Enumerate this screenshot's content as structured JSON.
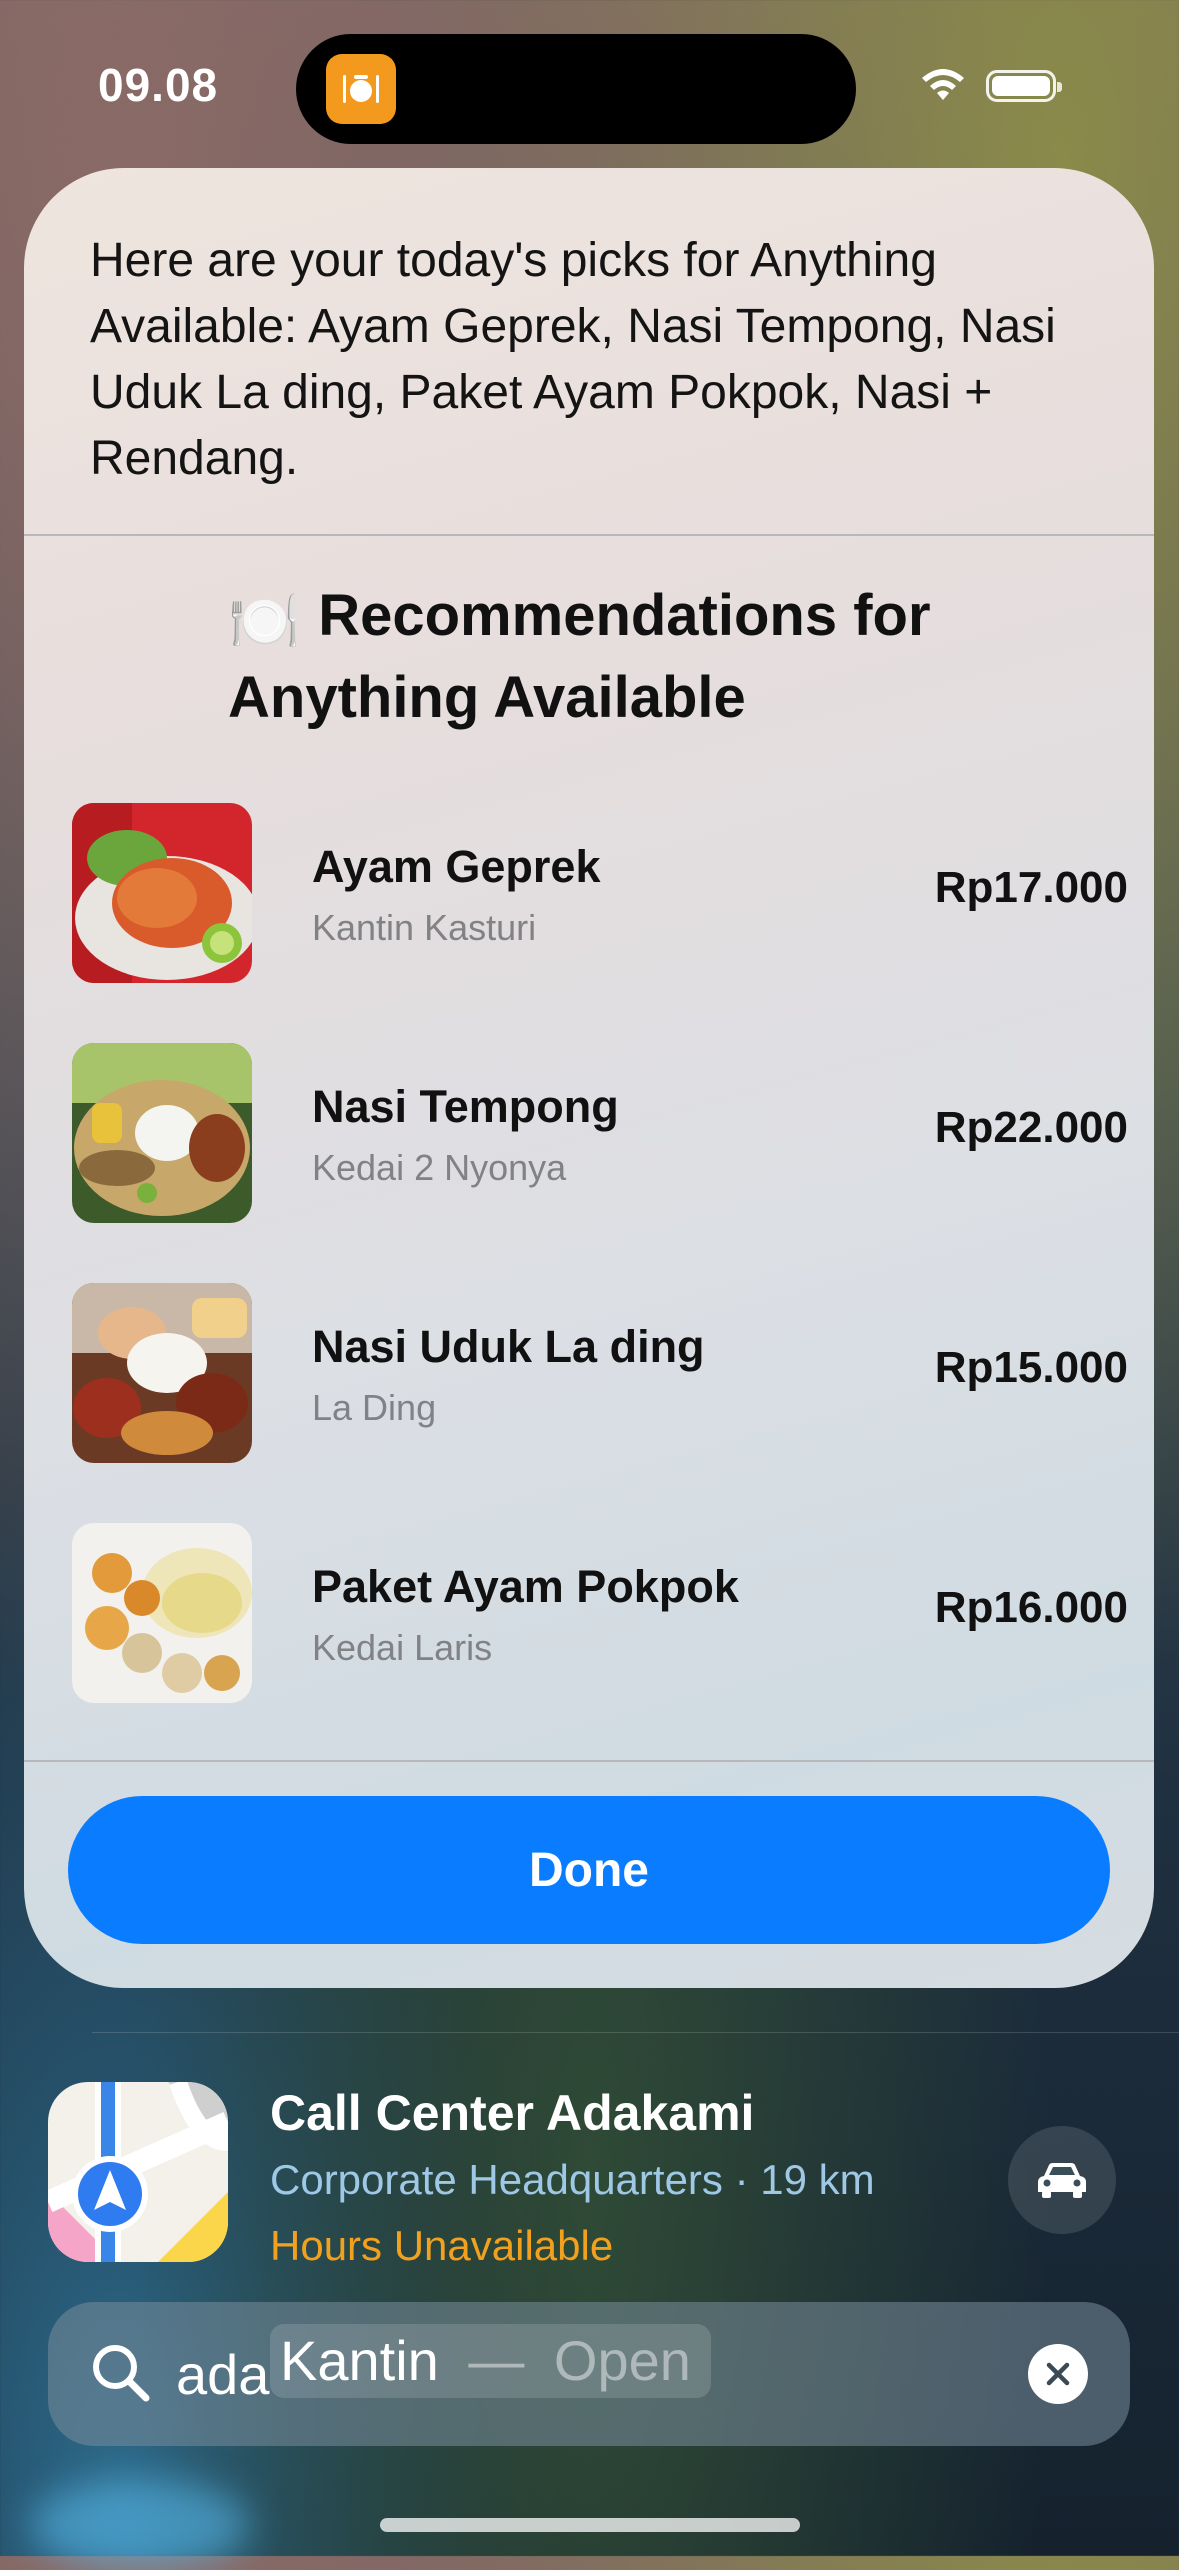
{
  "status_bar": {
    "time": "09.08",
    "island_app_icon": "fork-plate-icon",
    "wifi_icon": "wifi-icon",
    "battery_icon": "battery-full-icon"
  },
  "sheet": {
    "intro_text": "Here are your today's picks for Anything Available: Ayam Geprek, Nasi Tempong, Nasi Uduk La ding, Paket Ayam Pokpok, Nasi + Rendang.",
    "rec_emoji": "🍽️",
    "rec_title": "Recommendations for Anything Available",
    "items": [
      {
        "name": "Ayam Geprek",
        "shop": "Kantin Kasturi",
        "price": "Rp17.000"
      },
      {
        "name": "Nasi Tempong",
        "shop": "Kedai 2 Nyonya",
        "price": "Rp22.000"
      },
      {
        "name": "Nasi Uduk La ding",
        "shop": "La Ding",
        "price": "Rp15.000"
      },
      {
        "name": "Paket Ayam Pokpok",
        "shop": "Kedai Laris",
        "price": "Rp16.000"
      }
    ],
    "done_label": "Done"
  },
  "map_result": {
    "name": "Call Center Adakami",
    "meta": "Corporate Headquarters · 19 km",
    "hours": "Hours Unavailable",
    "app_icon": "maps-app-icon",
    "action_icon": "car-icon"
  },
  "search": {
    "typed": "ada",
    "suggestion": "Kantin",
    "suggestion_separator": "—",
    "suggestion_hint": "Open",
    "clear_icon": "clear-icon"
  },
  "colors": {
    "accent_blue": "#0a7cff",
    "hours_orange": "#f2a11f",
    "island_app_orange": "#f39a1e"
  }
}
